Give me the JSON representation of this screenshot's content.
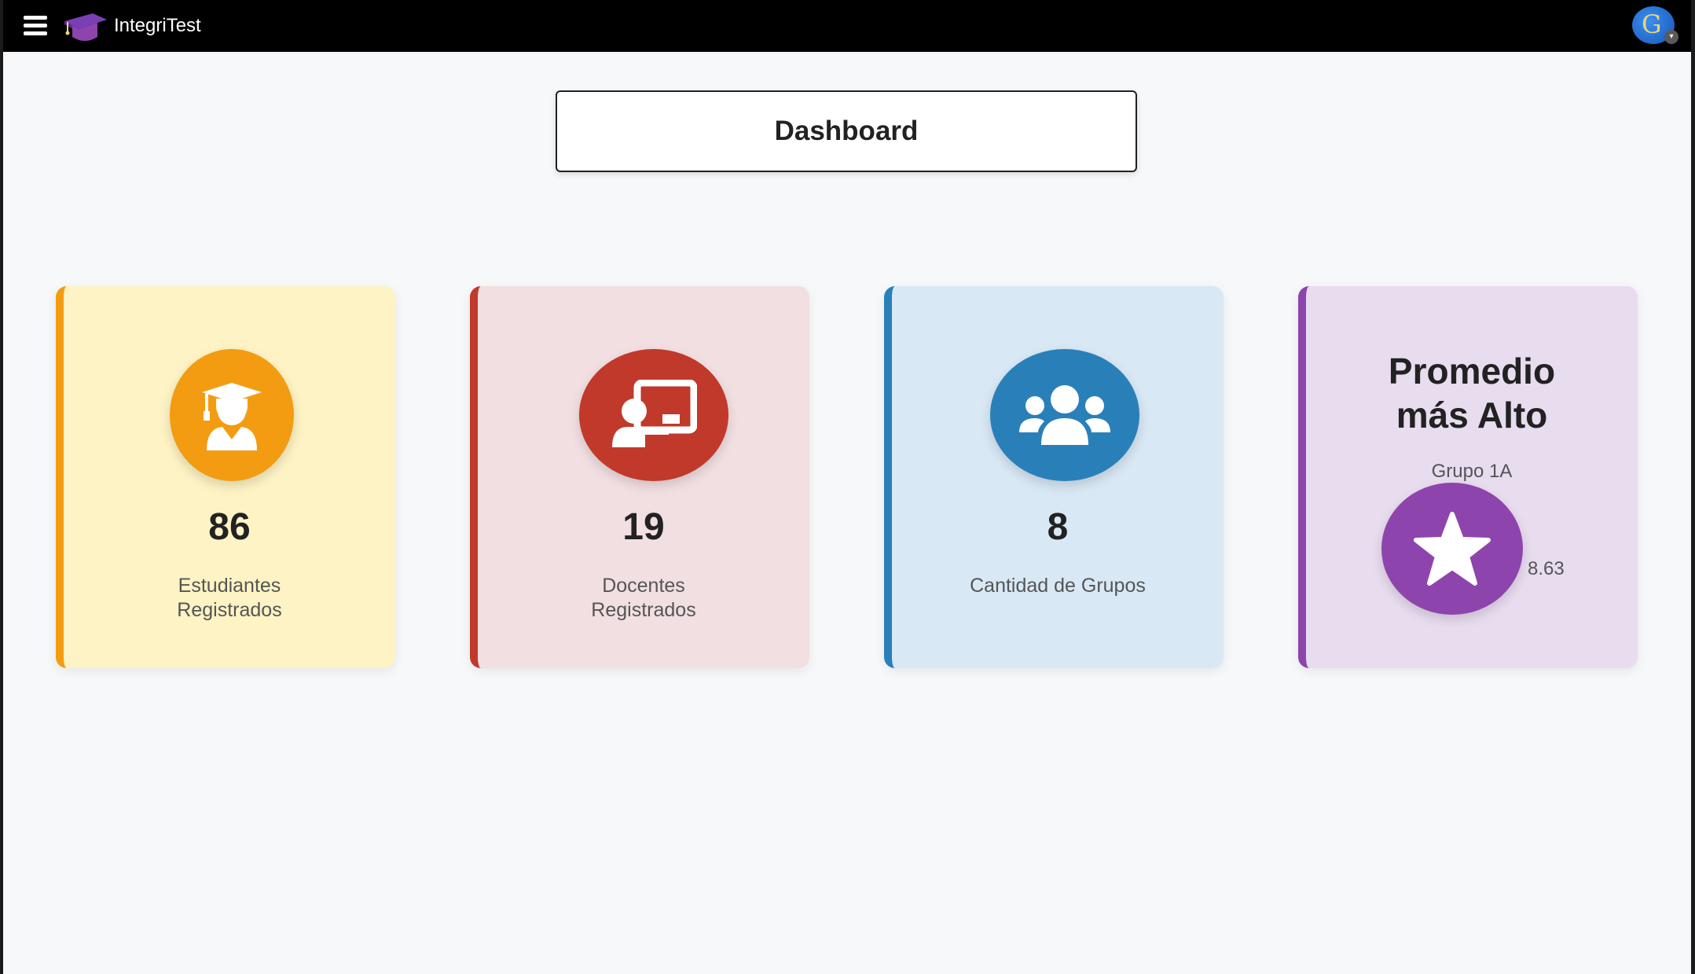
{
  "app": {
    "brand": "IntegriTest",
    "avatar_letter": "G"
  },
  "page": {
    "title": "Dashboard"
  },
  "cards": {
    "students": {
      "count": "86",
      "label_line1": "Estudiantes",
      "label_line2": "Registrados",
      "color": "#f39c12",
      "background": "#fdf3c4",
      "icon": "graduate-icon"
    },
    "teachers": {
      "count": "19",
      "label_line1": "Docentes",
      "label_line2": "Registrados",
      "color": "#c0392b",
      "background": "#f2dfe1",
      "icon": "teacher-board-icon"
    },
    "groups": {
      "count": "8",
      "label": "Cantidad de Grupos",
      "color": "#2980b9",
      "background": "#d9e8f5",
      "icon": "users-group-icon"
    },
    "top_average": {
      "title_line1": "Promedio",
      "title_line2": "más Alto",
      "group": "Grupo 1A",
      "score": "8.63",
      "color": "#8e44ad",
      "background": "#e8dcef",
      "icon": "star-icon"
    }
  },
  "icons": {
    "menu": "hamburger-menu-icon",
    "logo": "graduation-cap-logo",
    "avatar_caret": "chevron-down-icon"
  }
}
